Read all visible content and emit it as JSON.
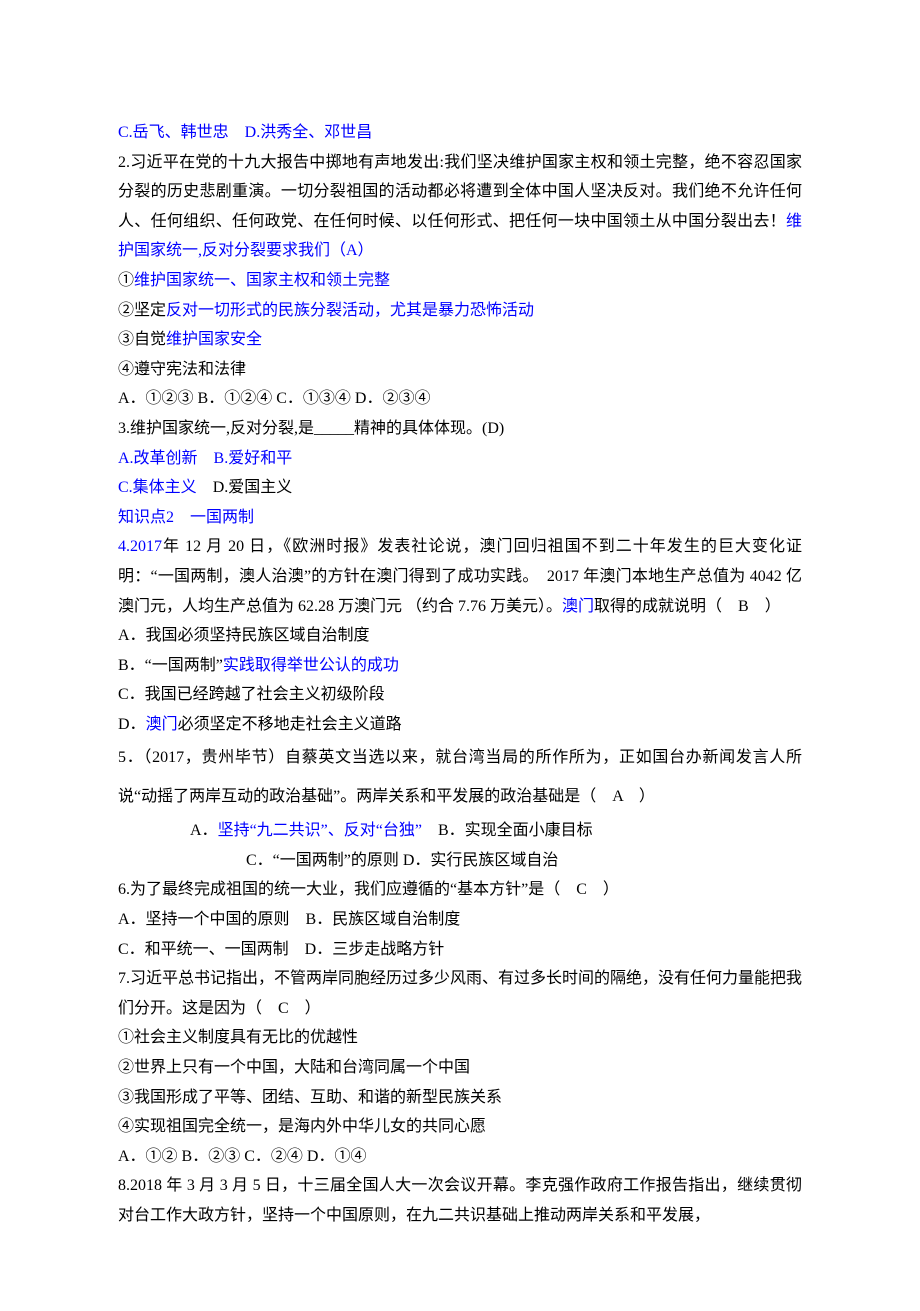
{
  "l1_opt_cd": "C.岳飞、韩世忠　D.洪秀全、邓世昌",
  "q2_stem": "2.习近平在党的十九大报告中掷地有声地发出:我们坚决维护国家主权和领土完整，绝不容忍国家分裂的历史悲剧重演。一切分裂祖国的活动都必将遭到全体中国人坚决反对。我们绝不允许任何人、任何组织、任何政党、在任何时候、以任何形式、把任何一块中国领土从中国分裂出去！",
  "q2_stem_tail_blue": "维护国家统一,反对分裂要求我们（A）",
  "q2_num1_pre": "①",
  "q2_num1_txt": "维护国家统一、国家主权和领土完整",
  "q2_num2_pre": "②坚定",
  "q2_num2_txt": "反对一切形式的民族分裂活动，尤其是暴力恐怖活动",
  "q2_num3_pre": "③自觉",
  "q2_num3_txt": "维护国家安全",
  "q2_num4": "④遵守宪法和法律",
  "q2_opts": "A．①②③ B．①②④ C．①③④ D．②③④",
  "q3_stem": "3.维护国家统一,反对分裂,是_____精神的具体体现。(D)",
  "q3_ab": "A.改革创新　B.爱好和平",
  "q3_c": "C.集体主义　",
  "q3_d": "D.爱国主义",
  "kp2": "知识点2　一国两制",
  "q4_p1_pre": "4.2017",
  "q4_p1_mid": "年 12 月 20 日，《欧洲时报》发表社论说，澳门回归祖国不到二十年发生的巨大变化证明：“一国两制，澳人治澳”的方针在澳门得到了成功实践。　2017 年澳门本地生产总值为 4042 亿澳门元，人均生产总值为 62.28 万澳门元 （约合 7.76 万美元）。",
  "q4_p1_macau": "澳门",
  "q4_p1_tail": "取得的成就说明（　B　）",
  "q4_a": "A．我国必须坚持民族区域自治制度",
  "q4_b_pre": "B．“一国两制”",
  "q4_b_tail": "实践取得举世公认的成功",
  "q4_c": "C．我国已经跨越了社会主义初级阶段",
  "q4_d_pre": "D．",
  "q4_d_macau": "澳门",
  "q4_d_tail": "必须坚定不移地走社会主义道路",
  "q5_stem": "5．（2017，贵州毕节）自蔡英文当选以来，就台湾当局的所作所为，正如国台办新闻发言人所说“动摇了两岸互动的政治基础”。两岸关系和平发展的政治基础是（　A　）",
  "q5_a_pre": "A．",
  "q5_a_txt": "坚持“九二共识”、反对“台独”",
  "q5_b": "　B．实现全面小康目标",
  "q5_cd": "C．“一国两制”的原则 D．实行民族区域自治",
  "q6_stem": "6.为了最终完成祖国的统一大业，我们应遵循的“基本方针”是（　C　）",
  "q6_ab": "A．坚持一个中国的原则　B．民族区域自治制度",
  "q6_cd": "C．和平统一、一国两制　D．三步走战略方针",
  "q7_stem": "7.习近平总书记指出，不管两岸同胞经历过多少风雨、有过多长时间的隔绝，没有任何力量能把我们分开。这是因为（　C　）",
  "q7_1": "①社会主义制度具有无比的优越性",
  "q7_2": "②世界上只有一个中国，大陆和台湾同属一个中国",
  "q7_3": "③我国形成了平等、团结、互助、和谐的新型民族关系",
  "q7_4": "④实现祖国完全统一，是海内外中华儿女的共同心愿",
  "q7_opts": "A．①② B．②③ C．②④ D．①④",
  "q8": "8.2018 年 3 月 3 月 5 日，十三届全国人大一次会议开幕。李克强作政府工作报告指出，继续贯彻对台工作大政方针，坚持一个中国原则，在九二共识基础上推动两岸关系和平发展，"
}
